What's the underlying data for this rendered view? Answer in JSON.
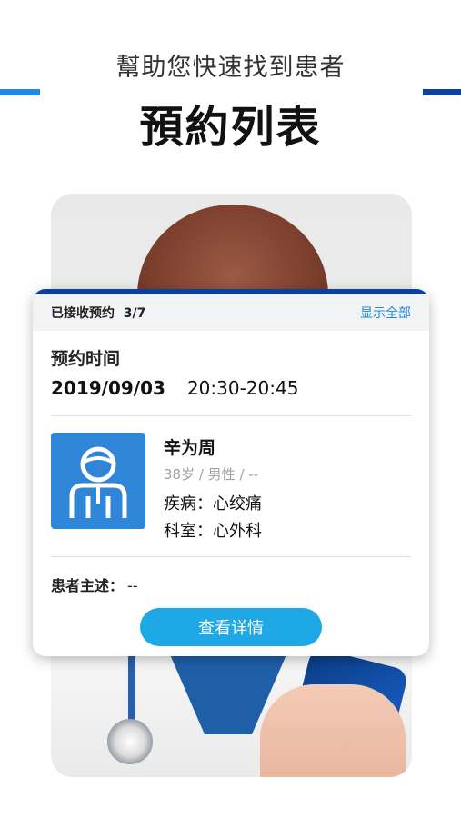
{
  "promo": {
    "subtitle": "幫助您快速找到患者",
    "headline": "預約列表"
  },
  "card": {
    "received_label": "已接收预约",
    "received_count": "3/7",
    "show_all": "显示全部",
    "appointment_label": "预约时间",
    "appointment_date": "2019/09/03",
    "appointment_range": "20:30-20:45",
    "patient": {
      "name": "辛为周",
      "meta": "38岁 / 男性 / --",
      "disease_label": "疾病：",
      "disease_value": "心绞痛",
      "department_label": "科室：",
      "department_value": "心外科",
      "avatar_icon": "doctor-avatar-icon"
    },
    "complaint_label": "患者主述：",
    "complaint_value": "--",
    "detail_button": "查看详情"
  },
  "colors": {
    "accent_blue": "#1e88e5",
    "dark_blue": "#0d3f9f",
    "button_blue": "#1ea9e6",
    "avatar_blue": "#2f86d8"
  }
}
